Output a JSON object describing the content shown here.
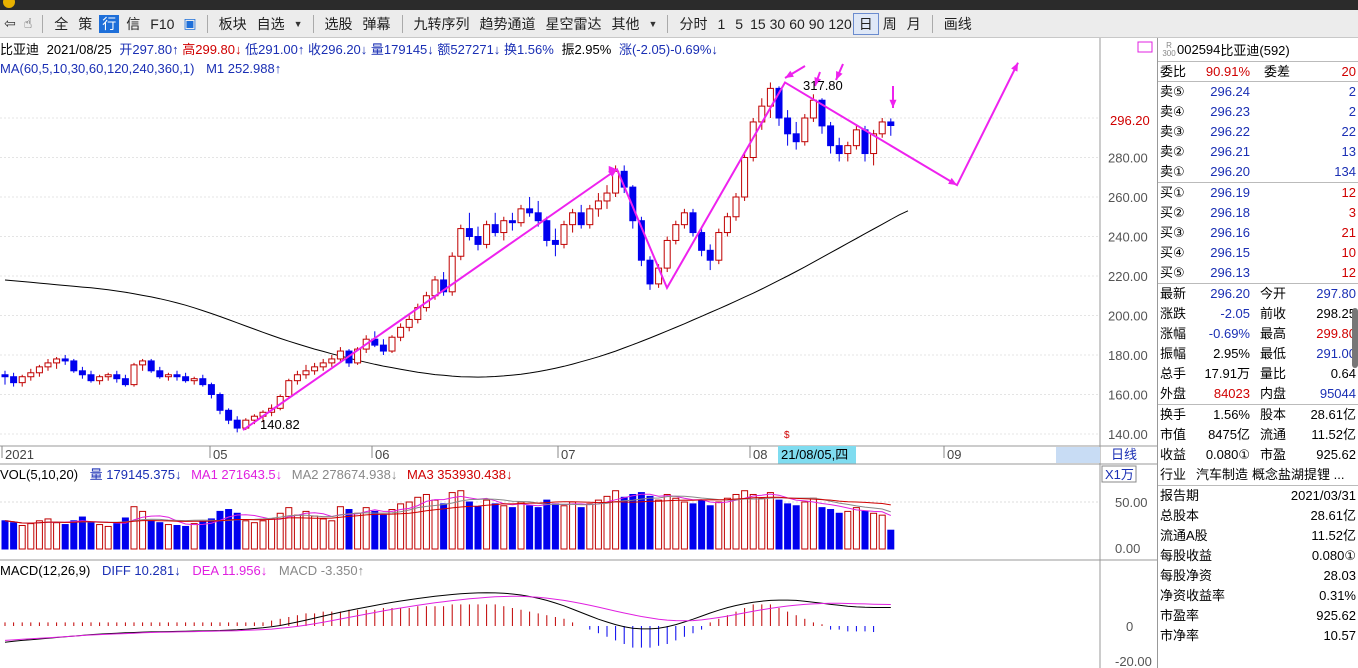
{
  "toolbar": {
    "items": [
      "全",
      "策",
      "行",
      "信",
      "F10",
      "板块",
      "自选",
      "选股",
      "弹幕",
      "九转序列",
      "趋势通道",
      "星空雷达",
      "其他",
      "分时",
      "1",
      "5",
      "15",
      "30",
      "60",
      "90",
      "120",
      "日",
      "周",
      "月",
      "画线"
    ],
    "active_tab": "行",
    "selected_period": "日"
  },
  "info_line": {
    "name": "比亚迪",
    "date": "2021/08/25",
    "open": "开297.80↑",
    "high": "高299.80↓",
    "low": "低291.00↑",
    "close": "收296.20↓",
    "volume": "量179145↓",
    "amount": "额527271↓",
    "turnover": "换1.56%",
    "amplitude": "振2.95%",
    "change": "涨(-2.05)-0.69%↓"
  },
  "ma_line": {
    "label": "MA(60,5,10,30,60,120,240,360,1)",
    "m1": "M1 252.988↑"
  },
  "annotations": {
    "high": "317.80",
    "low": "140.82"
  },
  "price_axis": [
    "300.00",
    "280.00",
    "260.00",
    "240.00",
    "220.00",
    "200.00",
    "180.00",
    "160.00",
    "140.00"
  ],
  "last_price_tag": "296.20",
  "date_axis": [
    "2021",
    "05",
    "06",
    "07",
    "08",
    "09"
  ],
  "date_cursor": "21/08/05,四",
  "period_label": "日线",
  "vol": {
    "label": "VOL(5,10,20)",
    "vol": "量 179145.375↓",
    "ma1": "MA1 271643.5↓",
    "ma2": "MA2 278674.938↓",
    "ma3": "MA3 353930.438↓",
    "unit": "X1万",
    "axis": [
      "50.00",
      "0.00"
    ]
  },
  "macd": {
    "label": "MACD(12,26,9)",
    "diff": "DIFF 10.281↓",
    "dea": "DEA 11.956↓",
    "macd": "MACD -3.350↑",
    "axis": [
      "0",
      "-20.00"
    ]
  },
  "colors": {
    "up": "#c00000",
    "down": "#0000ee",
    "trend": "#ee22ee",
    "ma": "#000000"
  },
  "quote": {
    "logo_top": "R",
    "logo_bottom": "300",
    "code": "002594",
    "name": "比亚迪(592)",
    "weibi_label": "委比",
    "weibi": "90.91%",
    "weicha_label": "委差",
    "weicha": "20",
    "asks": [
      {
        "label": "卖⑤",
        "price": "296.24",
        "vol": "2"
      },
      {
        "label": "卖④",
        "price": "296.23",
        "vol": "2"
      },
      {
        "label": "卖③",
        "price": "296.22",
        "vol": "22"
      },
      {
        "label": "卖②",
        "price": "296.21",
        "vol": "13"
      },
      {
        "label": "卖①",
        "price": "296.20",
        "vol": "134"
      }
    ],
    "bids": [
      {
        "label": "买①",
        "price": "296.19",
        "vol": "12"
      },
      {
        "label": "买②",
        "price": "296.18",
        "vol": "3"
      },
      {
        "label": "买③",
        "price": "296.16",
        "vol": "21"
      },
      {
        "label": "买④",
        "price": "296.15",
        "vol": "10"
      },
      {
        "label": "买⑤",
        "price": "296.13",
        "vol": "12"
      }
    ],
    "stats": [
      {
        "l1": "最新",
        "v1": "296.20",
        "l2": "今开",
        "v2": "297.80"
      },
      {
        "l1": "涨跌",
        "v1": "-2.05",
        "l2": "前收",
        "v2": "298.25"
      },
      {
        "l1": "涨幅",
        "v1": "-0.69%",
        "l2": "最高",
        "v2": "299.80"
      },
      {
        "l1": "振幅",
        "v1": "2.95%",
        "l2": "最低",
        "v2": "291.00"
      },
      {
        "l1": "总手",
        "v1": "17.91万",
        "l2": "量比",
        "v2": "0.64"
      },
      {
        "l1": "外盘",
        "v1": "84023",
        "l2": "内盘",
        "v2": "95044"
      }
    ],
    "stats2": [
      {
        "l1": "换手",
        "v1": "1.56%",
        "l2": "股本",
        "v2": "28.61亿"
      },
      {
        "l1": "市值",
        "v1": "8475亿",
        "l2": "流通",
        "v2": "11.52亿"
      },
      {
        "l1": "收益",
        "v1": "0.080①",
        "l2": "市盈",
        "v2": "925.62"
      }
    ],
    "industry_label": "行业",
    "industry": "汽车制造",
    "concept": "概念盐湖提锂 ...",
    "fin": [
      {
        "l": "报告期",
        "v": "2021/03/31"
      },
      {
        "l": "总股本",
        "v": "28.61亿"
      },
      {
        "l": "流通A股",
        "v": "11.52亿"
      },
      {
        "l": "每股收益",
        "v": "0.080①"
      },
      {
        "l": "每股净资",
        "v": "28.03"
      },
      {
        "l": "净资收益率",
        "v": "0.31%"
      },
      {
        "l": "市盈率",
        "v": "925.62"
      },
      {
        "l": "市净率",
        "v": "10.57"
      }
    ]
  },
  "chart_data": {
    "type": "candlestick",
    "title": "比亚迪",
    "xlabel": "",
    "ylabel": "",
    "ylim": [
      136,
      326
    ],
    "trend_points": [
      [
        140.82,
        "2021-05-06"
      ],
      [
        274,
        "2021-07-20"
      ],
      [
        214,
        "2021-07-30"
      ],
      [
        318,
        "2021-08-11"
      ],
      [
        266,
        "2021-09-01"
      ],
      [
        328,
        "2021-09-05"
      ]
    ],
    "candles": [
      [
        170,
        172,
        165,
        169
      ],
      [
        169,
        171,
        164,
        166
      ],
      [
        166,
        170,
        164,
        169
      ],
      [
        169,
        173,
        167,
        171
      ],
      [
        171,
        175,
        169,
        174
      ],
      [
        174,
        178,
        172,
        176
      ],
      [
        176,
        179,
        173,
        178
      ],
      [
        178,
        180,
        175,
        177
      ],
      [
        177,
        178,
        171,
        172
      ],
      [
        172,
        174,
        168,
        170
      ],
      [
        170,
        172,
        166,
        167
      ],
      [
        167,
        170,
        165,
        169
      ],
      [
        169,
        171,
        167,
        170
      ],
      [
        170,
        172,
        166,
        168
      ],
      [
        168,
        170,
        164,
        165
      ],
      [
        165,
        176,
        164,
        175
      ],
      [
        175,
        178,
        172,
        177
      ],
      [
        177,
        178,
        171,
        172
      ],
      [
        172,
        174,
        168,
        169
      ],
      [
        169,
        171,
        167,
        170
      ],
      [
        170,
        172,
        167,
        169
      ],
      [
        169,
        171,
        166,
        167
      ],
      [
        167,
        169,
        165,
        168
      ],
      [
        168,
        170,
        164,
        165
      ],
      [
        165,
        166,
        158,
        160
      ],
      [
        160,
        161,
        150,
        152
      ],
      [
        152,
        153,
        145,
        147
      ],
      [
        147,
        149,
        140.82,
        143
      ],
      [
        143,
        148,
        142,
        147
      ],
      [
        147,
        150,
        145,
        149
      ],
      [
        149,
        152,
        146,
        151
      ],
      [
        151,
        155,
        149,
        153
      ],
      [
        153,
        160,
        152,
        159
      ],
      [
        159,
        168,
        158,
        167
      ],
      [
        167,
        172,
        165,
        170
      ],
      [
        170,
        175,
        168,
        172
      ],
      [
        172,
        176,
        170,
        174
      ],
      [
        174,
        178,
        172,
        176
      ],
      [
        176,
        180,
        174,
        178
      ],
      [
        178,
        184,
        176,
        182
      ],
      [
        182,
        183,
        174,
        176
      ],
      [
        176,
        184,
        175,
        183
      ],
      [
        183,
        190,
        181,
        188
      ],
      [
        188,
        192,
        184,
        185
      ],
      [
        185,
        188,
        180,
        182
      ],
      [
        182,
        190,
        181,
        189
      ],
      [
        189,
        196,
        187,
        194
      ],
      [
        194,
        200,
        192,
        198
      ],
      [
        198,
        206,
        196,
        204
      ],
      [
        204,
        212,
        202,
        210
      ],
      [
        210,
        220,
        208,
        218
      ],
      [
        218,
        222,
        210,
        212
      ],
      [
        212,
        232,
        210,
        230
      ],
      [
        230,
        246,
        228,
        244
      ],
      [
        244,
        252,
        238,
        240
      ],
      [
        240,
        245,
        233,
        236
      ],
      [
        236,
        248,
        234,
        246
      ],
      [
        246,
        252,
        240,
        242
      ],
      [
        242,
        250,
        238,
        248
      ],
      [
        248,
        252,
        243,
        247
      ],
      [
        247,
        256,
        245,
        254
      ],
      [
        254,
        260,
        250,
        252
      ],
      [
        252,
        258,
        245,
        248
      ],
      [
        248,
        250,
        235,
        238
      ],
      [
        238,
        244,
        230,
        236
      ],
      [
        236,
        248,
        234,
        246
      ],
      [
        246,
        254,
        242,
        252
      ],
      [
        252,
        256,
        244,
        246
      ],
      [
        246,
        256,
        244,
        254
      ],
      [
        254,
        262,
        250,
        258
      ],
      [
        258,
        266,
        254,
        262
      ],
      [
        262,
        276,
        260,
        273
      ],
      [
        273,
        276,
        262,
        265
      ],
      [
        265,
        266,
        244,
        248
      ],
      [
        248,
        250,
        225,
        228
      ],
      [
        228,
        230,
        213,
        216
      ],
      [
        216,
        226,
        214,
        224
      ],
      [
        224,
        240,
        222,
        238
      ],
      [
        238,
        248,
        236,
        246
      ],
      [
        246,
        254,
        244,
        252
      ],
      [
        252,
        254,
        240,
        242
      ],
      [
        242,
        244,
        230,
        233
      ],
      [
        233,
        236,
        223,
        228
      ],
      [
        228,
        244,
        226,
        242
      ],
      [
        242,
        252,
        240,
        250
      ],
      [
        250,
        262,
        248,
        260
      ],
      [
        260,
        282,
        258,
        280
      ],
      [
        280,
        300,
        278,
        298
      ],
      [
        298,
        310,
        294,
        306
      ],
      [
        306,
        318,
        300,
        315
      ],
      [
        315,
        316,
        296,
        300
      ],
      [
        300,
        304,
        286,
        292
      ],
      [
        292,
        298,
        284,
        288
      ],
      [
        288,
        302,
        286,
        300
      ],
      [
        300,
        312,
        298,
        309
      ],
      [
        309,
        310,
        292,
        296
      ],
      [
        296,
        298,
        282,
        286
      ],
      [
        286,
        290,
        278,
        282
      ],
      [
        282,
        288,
        278,
        286
      ],
      [
        286,
        296,
        284,
        294
      ],
      [
        294,
        296,
        278,
        282
      ],
      [
        282,
        294,
        276,
        292
      ],
      [
        292,
        300,
        290,
        298
      ],
      [
        298,
        299.8,
        291,
        296.2
      ]
    ],
    "ma60": [
      218,
      217.6,
      217.2,
      216.8,
      216.4,
      216,
      215.6,
      215.2,
      214.8,
      214.4,
      214,
      213.5,
      213,
      212.4,
      211.8,
      211,
      210.2,
      209.4,
      208.5,
      207.5,
      206.4,
      205.2,
      203.9,
      202.5,
      201,
      199.5,
      197.9,
      196.3,
      194.7,
      193.1,
      191.5,
      189.9,
      188.4,
      187,
      185.6,
      184.3,
      183,
      181.8,
      180.6,
      179.5,
      178.4,
      177.3,
      176.3,
      175.3,
      174.4,
      173.6,
      172.8,
      172,
      171.3,
      170.7,
      170.1,
      169.7,
      169.3,
      169,
      168.9,
      168.8,
      168.9,
      169.1,
      169.4,
      169.8,
      170.3,
      170.9,
      171.6,
      172.4,
      173.3,
      174.3,
      175.4,
      176.6,
      177.8,
      179.1,
      180.5,
      182,
      183.6,
      185.2,
      186.9,
      188.6,
      190.4,
      192.2,
      194,
      195.8,
      197.7,
      199.6,
      201.5,
      203.4,
      205.3,
      207.3,
      209.3,
      211.3,
      213.4,
      215.6,
      217.8,
      220,
      222.3,
      224.6,
      227,
      229.4,
      231.8,
      234.2,
      236.6,
      239,
      241.4,
      243.8,
      246.2,
      248.6,
      251,
      252.988
    ],
    "vol": [
      30,
      28,
      25,
      27,
      30,
      32,
      28,
      26,
      30,
      34,
      28,
      26,
      24,
      27,
      33,
      45,
      40,
      30,
      28,
      26,
      25,
      24,
      27,
      29,
      32,
      40,
      42,
      38,
      30,
      28,
      30,
      32,
      38,
      44,
      36,
      40,
      35,
      32,
      30,
      45,
      42,
      38,
      44,
      40,
      36,
      42,
      48,
      50,
      55,
      58,
      52,
      48,
      60,
      62,
      50,
      45,
      52,
      48,
      46,
      44,
      50,
      46,
      44,
      52,
      48,
      46,
      50,
      44,
      48,
      52,
      56,
      62,
      55,
      58,
      60,
      56,
      52,
      58,
      54,
      50,
      48,
      52,
      46,
      50,
      54,
      58,
      62,
      58,
      54,
      60,
      52,
      48,
      46,
      50,
      54,
      44,
      42,
      38,
      40,
      44,
      40,
      38,
      36,
      20
    ],
    "macd_hist": [
      2,
      2,
      2,
      2,
      2,
      2,
      2,
      2,
      2,
      2,
      2,
      2,
      2,
      2,
      2,
      2,
      2,
      2,
      2,
      2,
      2,
      2,
      2,
      2,
      2,
      2,
      2,
      2,
      2,
      2,
      2,
      3,
      4,
      5,
      6,
      7,
      7,
      8,
      8,
      8,
      9,
      9,
      9,
      9,
      10,
      10,
      10,
      10,
      11,
      11,
      11,
      11,
      12,
      12,
      12,
      12,
      12,
      12,
      11,
      10,
      9,
      8,
      7,
      6,
      5,
      4,
      2,
      0,
      -2,
      -4,
      -6,
      -8,
      -10,
      -12,
      -12,
      -12,
      -11,
      -10,
      -8,
      -6,
      -4,
      -2,
      2,
      4,
      6,
      8,
      10,
      12,
      12,
      12,
      10,
      8,
      6,
      4,
      2,
      1,
      -2,
      -2,
      -3,
      -3,
      -3,
      -3.35
    ],
    "diff": [
      -9,
      -8.5,
      -8,
      -7.6,
      -7.2,
      -6.8,
      -6.4,
      -6,
      -5.6,
      -5.2,
      -4.8,
      -4.5,
      -4.2,
      -4,
      -3.8,
      -3.6,
      -3.4,
      -3.3,
      -3.2,
      -3.1,
      -3,
      -2.9,
      -2.8,
      -2.7,
      -2.6,
      -2.5,
      -2.3,
      -2.1,
      -1.8,
      -1.4,
      -1,
      -0.4,
      0.3,
      1.2,
      2.2,
      3.3,
      4.4,
      5.5,
      6.6,
      7.6,
      8.6,
      9.6,
      10.5,
      11.4,
      12.3,
      13.1,
      13.9,
      14.6,
      15.3,
      15.9,
      16.5,
      17,
      17.5,
      17.9,
      18.2,
      18.4,
      18.5,
      18.4,
      18.2,
      17.8,
      17.2,
      16.4,
      15.4,
      14.2,
      12.8,
      11.2,
      9.4,
      7.5,
      5.6,
      3.8,
      2.2,
      0.8,
      -0.4,
      -1.2,
      -1.6,
      -1.6,
      -1.2,
      -0.4,
      0.8,
      2.2,
      3.8,
      5.5,
      7.2,
      8.8,
      10.2,
      11.4,
      12.4,
      13.2,
      13.8,
      14.2,
      14.4,
      14.4,
      14.2,
      13.8,
      13.2,
      12.6,
      12,
      11.5,
      11,
      10.6,
      10.4,
      10.3,
      10.3,
      10.281
    ],
    "dea": [
      -8,
      -7.7,
      -7.4,
      -7.1,
      -6.8,
      -6.5,
      -6.2,
      -5.9,
      -5.6,
      -5.3,
      -5,
      -4.8,
      -4.6,
      -4.4,
      -4.2,
      -4,
      -3.8,
      -3.6,
      -3.5,
      -3.4,
      -3.3,
      -3.2,
      -3.1,
      -3,
      -2.9,
      -2.8,
      -2.7,
      -2.6,
      -2.4,
      -2.2,
      -2,
      -1.7,
      -1.3,
      -0.8,
      -0.2,
      0.5,
      1.3,
      2.1,
      3,
      3.9,
      4.8,
      5.7,
      6.6,
      7.5,
      8.4,
      9.2,
      10,
      10.8,
      11.5,
      12.2,
      12.9,
      13.5,
      14.1,
      14.6,
      15.1,
      15.5,
      15.9,
      16.2,
      16.4,
      16.5,
      16.5,
      16.3,
      16,
      15.5,
      14.9,
      14.2,
      13.4,
      12.5,
      11.5,
      10.5,
      9.4,
      8.3,
      7.2,
      6.2,
      5.3,
      4.5,
      3.8,
      3.3,
      3,
      2.9,
      3,
      3.4,
      4,
      4.7,
      5.5,
      6.4,
      7.3,
      8.2,
      9,
      9.8,
      10.5,
      11.1,
      11.6,
      12,
      12.3,
      12.5,
      12.6,
      12.6,
      12.5,
      12.4,
      12.3,
      12.1,
      12,
      11.956
    ]
  }
}
